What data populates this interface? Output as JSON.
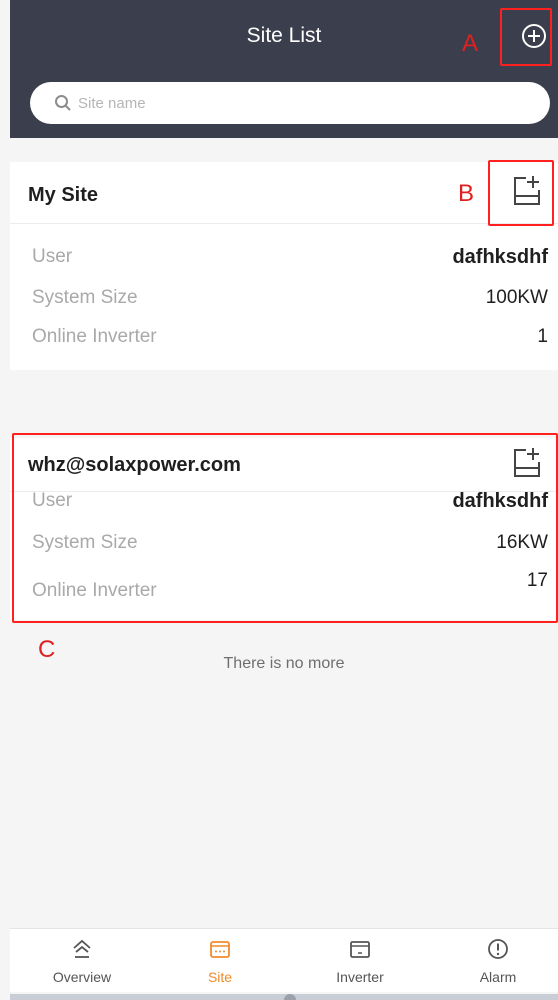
{
  "header": {
    "title": "Site List",
    "add_icon": "plus-circle-icon"
  },
  "search": {
    "placeholder": "Site name",
    "icon": "search-icon"
  },
  "annotations": {
    "a": "A",
    "b": "B",
    "c": "C",
    "color": "#ff2020"
  },
  "sites": [
    {
      "name": "My Site",
      "edit_icon": "edit-site-icon",
      "rows": [
        {
          "label": "User",
          "value": "dafhksdhf"
        },
        {
          "label": "System Size",
          "value": "100KW"
        },
        {
          "label": "Online Inverter",
          "value": "1"
        }
      ]
    },
    {
      "name": "whz@solaxpower.com",
      "edit_icon": "edit-site-icon",
      "rows": [
        {
          "label": "User",
          "value": "dafhksdhf"
        },
        {
          "label": "System Size",
          "value": "16KW"
        },
        {
          "label": "Online Inverter",
          "value": "17"
        }
      ]
    }
  ],
  "list_end_text": "There is no more",
  "tabs": [
    {
      "label": "Overview",
      "icon": "home-icon"
    },
    {
      "label": "Site",
      "icon": "site-icon",
      "active": true
    },
    {
      "label": "Inverter",
      "icon": "inverter-icon"
    },
    {
      "label": "Alarm",
      "icon": "alarm-icon"
    }
  ],
  "colors": {
    "header_bg": "#3b3f4d",
    "accent": "#f08a2c",
    "annotation": "#ff2020"
  }
}
